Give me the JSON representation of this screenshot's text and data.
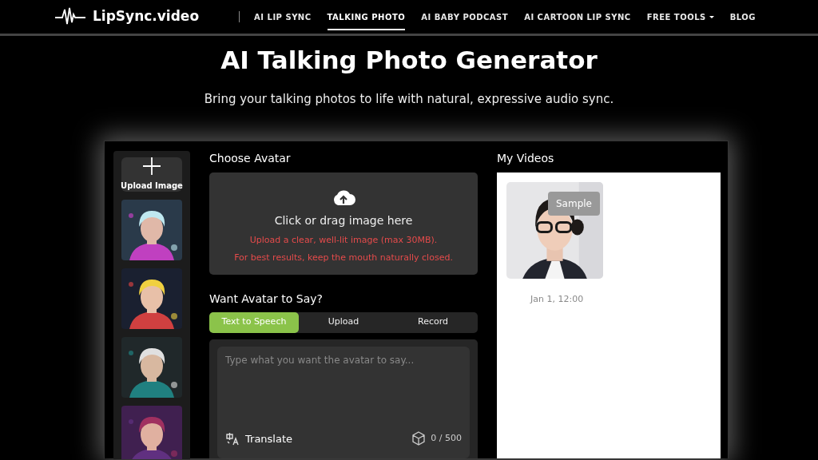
{
  "header": {
    "logo": "LipSync.video",
    "nav": [
      {
        "label": "AI LIP SYNC",
        "selected": false,
        "dropdown": false
      },
      {
        "label": "TALKING PHOTO",
        "selected": true,
        "dropdown": false
      },
      {
        "label": "AI BABY PODCAST",
        "selected": false,
        "dropdown": false
      },
      {
        "label": "AI CARTOON LIP SYNC",
        "selected": false,
        "dropdown": false
      },
      {
        "label": "FREE TOOLS",
        "selected": false,
        "dropdown": true
      },
      {
        "label": "BLOG",
        "selected": false,
        "dropdown": false
      }
    ]
  },
  "hero": {
    "title": "AI Talking Photo Generator",
    "subtitle": "Bring your talking photos to life with natural, expressive audio sync."
  },
  "sidebar": {
    "upload_label": "Upload Image"
  },
  "choose_avatar": {
    "heading": "Choose Avatar",
    "drop_text": "Click or drag image here",
    "hints": [
      "Upload a clear, well-lit image (max 30MB).",
      "For best results, keep the mouth naturally closed."
    ]
  },
  "speech": {
    "heading": "Want Avatar to Say?",
    "tabs": [
      {
        "label": "Text to Speech",
        "selected": true
      },
      {
        "label": "Upload",
        "selected": false
      },
      {
        "label": "Record",
        "selected": false
      }
    ],
    "text_field": {
      "placeholder": "Type what you want the avatar to say..."
    },
    "translate_label": "Translate",
    "count": "0 / 500"
  },
  "my_videos": {
    "heading": "My Videos",
    "videos": [
      {
        "kind": "picture",
        "badge": "Sample",
        "date": "Jan 1, 12:00"
      }
    ]
  }
}
